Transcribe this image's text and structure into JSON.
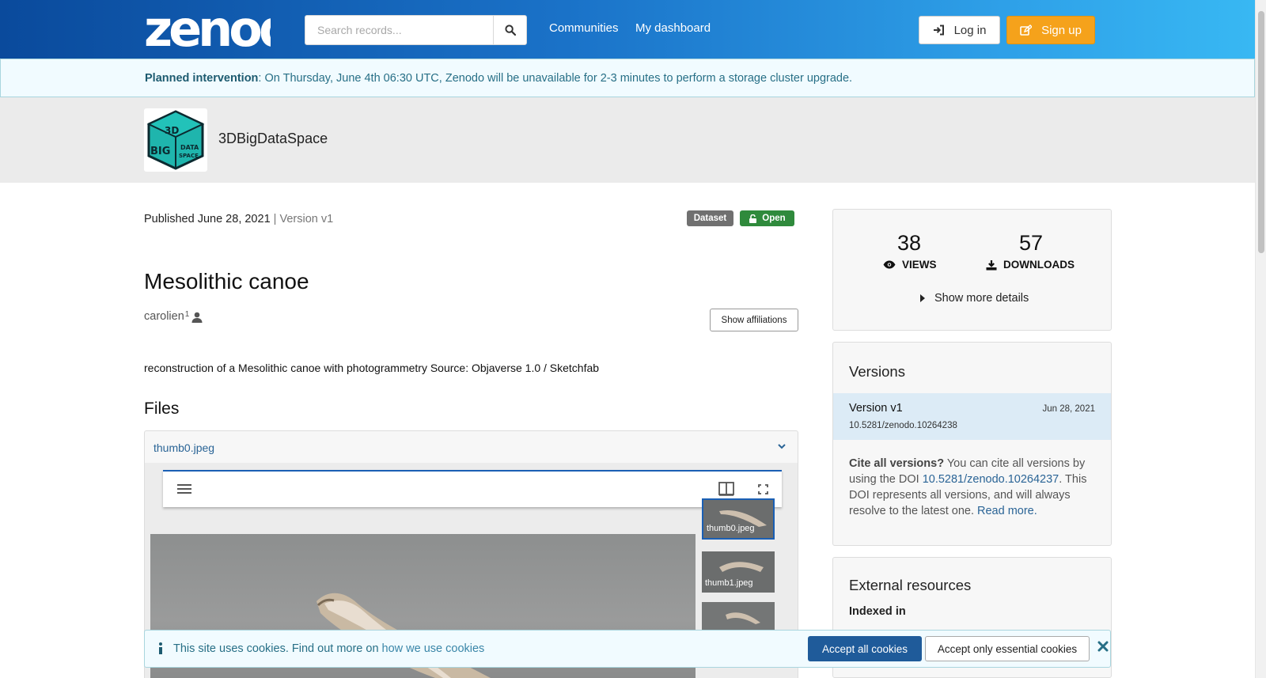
{
  "header": {
    "logo": "zenodo",
    "search_placeholder": "Search records...",
    "nav": [
      "Communities",
      "My dashboard"
    ],
    "login": "Log in",
    "signup": "Sign up"
  },
  "banner": {
    "label": "Planned intervention",
    "text": ": On Thursday, June 4th 06:30 UTC, Zenodo will be unavailable for 2-3 minutes to perform a storage cluster upgrade."
  },
  "community": {
    "name": "3DBigDataSpace",
    "logo_text": [
      "3D",
      "BIG",
      "DATA",
      "SPACE"
    ]
  },
  "record": {
    "published": "Published June 28, 2021",
    "sep": " | ",
    "version": "Version v1",
    "badge_type": "Dataset",
    "badge_access": "Open",
    "title": "Mesolithic canoe",
    "creator": "carolien",
    "creator_sup": "1",
    "show_affiliations": "Show affiliations",
    "description": "reconstruction of a Mesolithic canoe with photogrammetry Source: Objaverse 1.0 / Sketchfab",
    "files_heading": "Files",
    "file_name": "thumb0.jpeg",
    "thumbs": [
      "thumb0.jpeg",
      "thumb1.jpeg"
    ]
  },
  "stats": {
    "views": "38",
    "views_label": "VIEWS",
    "downloads": "57",
    "downloads_label": "DOWNLOADS",
    "more": "Show more details"
  },
  "versions": {
    "heading": "Versions",
    "name": "Version v1",
    "date": "Jun 28, 2021",
    "doi": "10.5281/zenodo.10264238",
    "cite_q": "Cite all versions?",
    "cite_1": " You can cite all versions by using the DOI ",
    "cite_doi": "10.5281/zenodo.10264237",
    "cite_2": ". This DOI represents all versions, and will always resolve to the latest one. ",
    "read_more": "Read more."
  },
  "external": {
    "heading": "External resources",
    "indexed": "Indexed in"
  },
  "cookies": {
    "text": "This site uses cookies. Find out more on ",
    "link": "how we use cookies",
    "accept_all": "Accept all cookies",
    "accept_essential": "Accept only essential cookies"
  },
  "colors": {
    "header_start": "#0a4a9c",
    "header_end": "#38b8f3",
    "signup": "#f5a21b",
    "open_badge": "#2f8a3c",
    "link": "#2a6496"
  }
}
